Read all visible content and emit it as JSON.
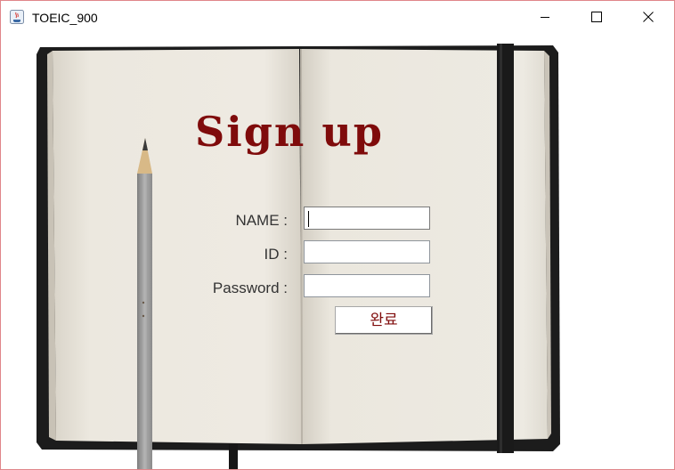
{
  "window": {
    "title": "TOEIC_900",
    "minimize_icon": "minimize-icon",
    "maximize_icon": "maximize-icon",
    "close_icon": "close-icon"
  },
  "form": {
    "heading": "Sign up",
    "name_label": "NAME :",
    "name_value": "",
    "id_label": "ID :",
    "id_value": "",
    "password_label": "Password :",
    "password_value": "",
    "submit_label": "완료"
  },
  "colors": {
    "heading": "#7f0b0b",
    "submit_text": "#7f0b0b",
    "window_border": "#e0868a"
  }
}
